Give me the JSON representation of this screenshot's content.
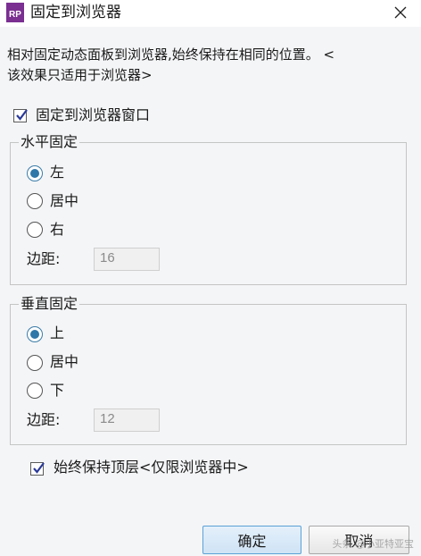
{
  "window": {
    "app_icon": "RP",
    "title": "固定到浏览器",
    "close_icon": "close-icon"
  },
  "description": {
    "line1": "相对固定动态面板到浏览器,始终保持在相同的位置。 <",
    "line2": "该效果只适用于浏览器>"
  },
  "pin_to_browser": {
    "label": "固定到浏览器窗口",
    "checked": true
  },
  "horizontal": {
    "title": "水平固定",
    "options": [
      "左",
      "居中",
      "右"
    ],
    "selected": "左",
    "margin_label": "边距:",
    "margin_value": "16"
  },
  "vertical": {
    "title": "垂直固定",
    "options": [
      "上",
      "居中",
      "下"
    ],
    "selected": "上",
    "margin_label": "边距:",
    "margin_value": "12"
  },
  "always_on_top": {
    "label": "始终保持顶层<仅限浏览器中>",
    "checked": true
  },
  "buttons": {
    "ok": "确定",
    "cancel": "取消"
  },
  "watermark": "头条 @小亚特亚宝",
  "colors": {
    "accent": "#2f77a8",
    "icon": "#7a2f91",
    "check": "#2a3a9a"
  }
}
